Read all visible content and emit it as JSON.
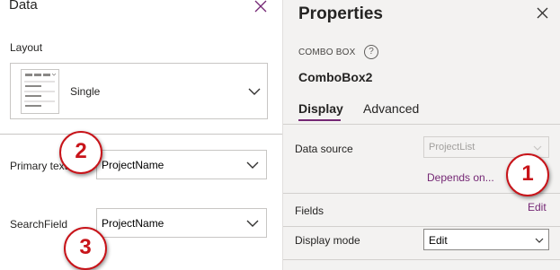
{
  "data_pane": {
    "title": "Data",
    "layout_label": "Layout",
    "layout_value": "Single",
    "primary_text_label": "Primary text",
    "primary_text_value": "ProjectName",
    "search_field_label": "SearchField",
    "search_field_value": "ProjectName"
  },
  "properties_pane": {
    "title": "Properties",
    "control_type": "COMBO BOX",
    "help_glyph": "?",
    "control_name": "ComboBox2",
    "tabs": [
      {
        "label": "Display",
        "active": true
      },
      {
        "label": "Advanced",
        "active": false
      }
    ],
    "data_source_label": "Data source",
    "data_source_value": "ProjectList",
    "depends_on_link": "Depends on...",
    "fields_label": "Fields",
    "fields_edit_link": "Edit",
    "display_mode_label": "Display mode",
    "display_mode_value": "Edit"
  },
  "callouts": [
    "1",
    "2",
    "3"
  ],
  "colors": {
    "accent": "#742774",
    "callout": "#c8141a",
    "pane_bg": "#f3f2f1"
  }
}
